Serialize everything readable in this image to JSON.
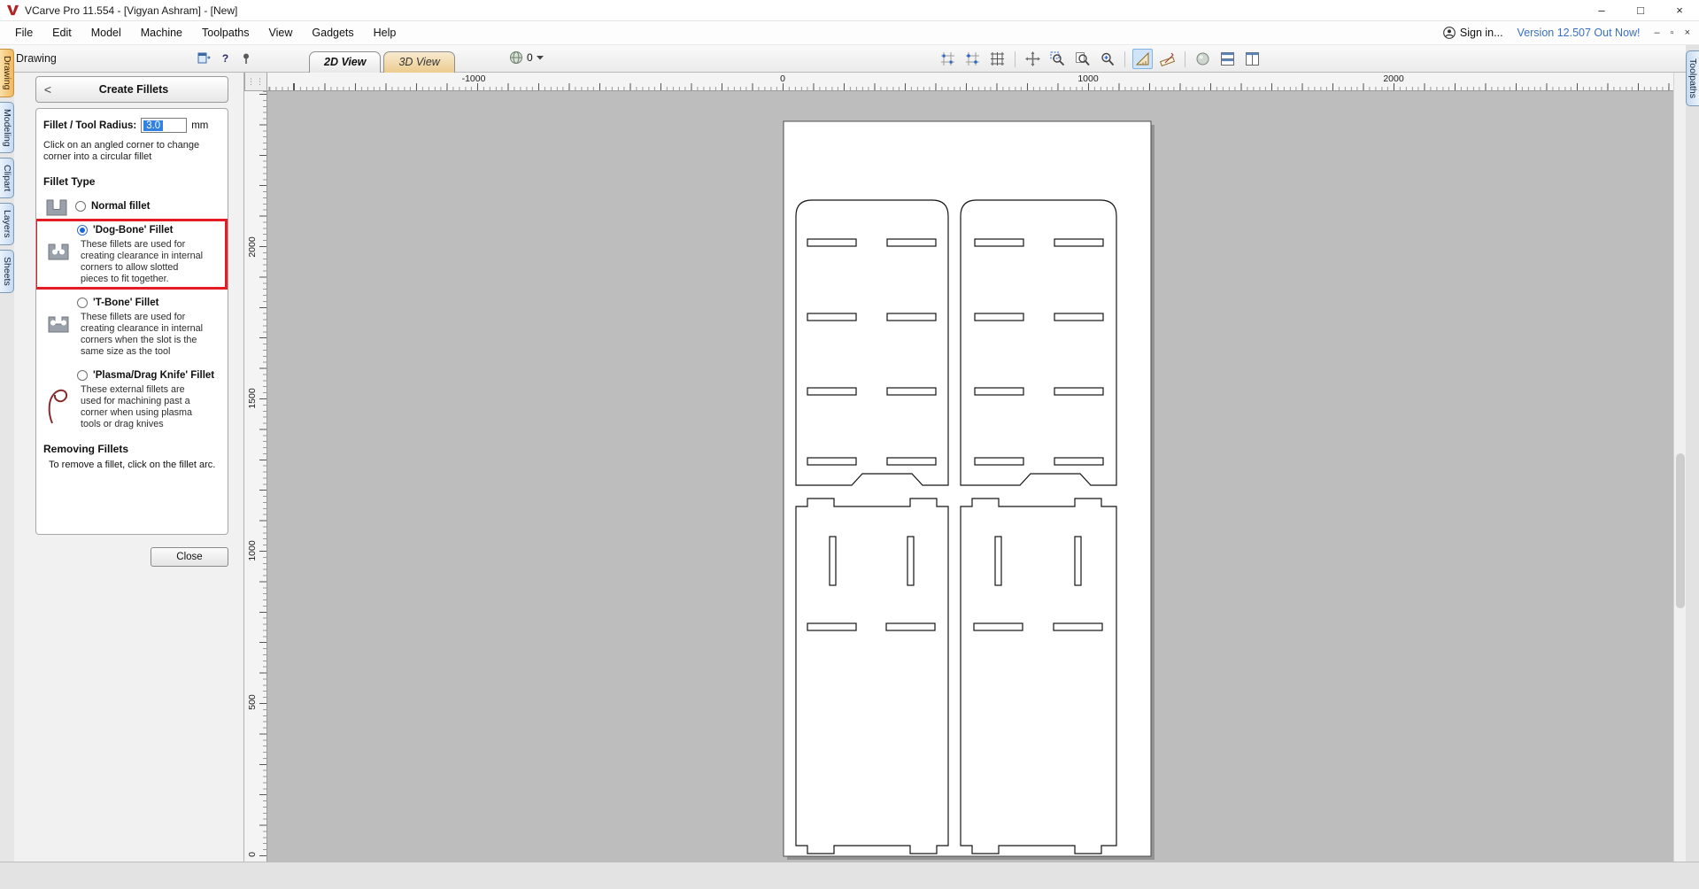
{
  "window": {
    "title": "VCarve Pro 11.554 - [Vigyan Ashram] - [New]",
    "controls": {
      "minimize": "–",
      "maximize": "□",
      "close": "×"
    }
  },
  "menubar": {
    "items": [
      "File",
      "Edit",
      "Model",
      "Machine",
      "Toolpaths",
      "View",
      "Gadgets",
      "Help"
    ],
    "sign_in": "Sign in...",
    "version_link": "Version 12.507 Out Now!",
    "mdi_controls": {
      "minimize": "–",
      "restore": "▫",
      "close": "×"
    }
  },
  "toolbar": {
    "panel_label": "Drawing",
    "help_label": "?",
    "tabs": [
      {
        "label": "2D View",
        "active": true
      },
      {
        "label": "3D View",
        "active": false
      }
    ],
    "sheet_value": "0",
    "icons": [
      "snap-to-geometry",
      "snap-to-grid",
      "toggle-grid",
      "move-view",
      "zoom-box",
      "zoom-to-drawing",
      "zoom-to-selection",
      "toggle-guides",
      "measure",
      "shaded-background",
      "tile-windows-horizontal",
      "tile-windows-vertical"
    ]
  },
  "side_tabs": {
    "left": [
      "Drawing",
      "Modeling",
      "Clipart",
      "Layers",
      "Sheets"
    ],
    "left_active": "Drawing",
    "right": [
      "Toolpaths"
    ]
  },
  "fillet_panel": {
    "title": "Create Fillets",
    "back_glyph": "<",
    "radius_label": "Fillet / Tool Radius:",
    "radius_value": "3.0",
    "radius_unit": "mm",
    "hint": "Click on an angled corner to change corner into a circular fillet",
    "type_heading": "Fillet Type",
    "options": [
      {
        "label": "Normal fillet",
        "selected": false,
        "description": ""
      },
      {
        "label": "'Dog-Bone' Fillet",
        "selected": true,
        "highlighted": true,
        "description": "These fillets are used for creating clearance in internal corners to allow slotted pieces to fit together."
      },
      {
        "label": "'T-Bone' Fillet",
        "selected": false,
        "description": "These fillets are used for creating clearance in internal corners when the slot is the same size as the tool"
      },
      {
        "label": "'Plasma/Drag Knife' Fillet",
        "selected": false,
        "description": "These external fillets are used for machining past a corner when using plasma tools or drag knives"
      }
    ],
    "removing_heading": "Removing Fillets",
    "removing_hint": "To remove a fillet, click on the fillet arc.",
    "close_label": "Close"
  },
  "rulers": {
    "horizontal": [
      "-1000",
      "0",
      "1000",
      "2000"
    ],
    "vertical": [
      "2000",
      "1500",
      "1000",
      "500",
      "0"
    ]
  },
  "colors": {
    "annotation_red": "#e51c23",
    "selection_blue": "#3181e3",
    "active_tab_orange": "#f0b95f",
    "version_link_blue": "#3a6fc9",
    "canvas_gray": "#bdbdbd"
  }
}
